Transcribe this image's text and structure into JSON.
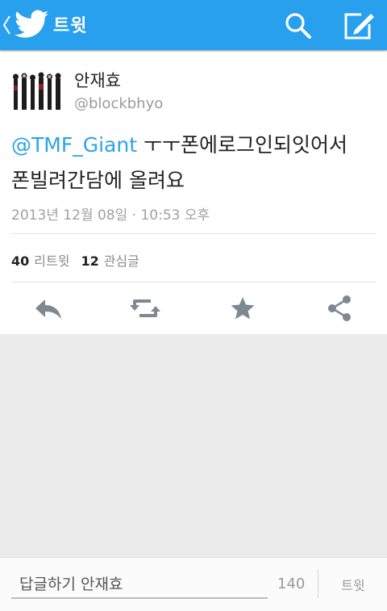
{
  "header": {
    "title": "트윗",
    "back_icon": "chevron-left-icon",
    "logo_icon": "twitter-bird-icon",
    "search_icon": "search-icon",
    "compose_icon": "compose-icon"
  },
  "tweet": {
    "author_name": "안재효",
    "author_handle": "@blockbhyo",
    "mention": "@TMF_Giant",
    "text_line1_rest": " ㅜㅜ폰에로그인되잇어서",
    "text_line2": "폰빌려간담에 올려요",
    "timestamp": "2013년 12월 08일 · 10:53 오후",
    "retweet_count": "40",
    "retweet_label": "리트윗",
    "favorite_count": "12",
    "favorite_label": "관심글"
  },
  "actions": {
    "reply_icon": "reply-icon",
    "retweet_icon": "retweet-icon",
    "favorite_icon": "star-icon",
    "share_icon": "share-icon"
  },
  "composer": {
    "placeholder": "답글하기 안재효",
    "char_count": "140",
    "send_label": "트윗"
  },
  "colors": {
    "brand_blue": "#28a0ed",
    "mention_blue": "#2ba4e8",
    "icon_gray": "#7d8890"
  }
}
